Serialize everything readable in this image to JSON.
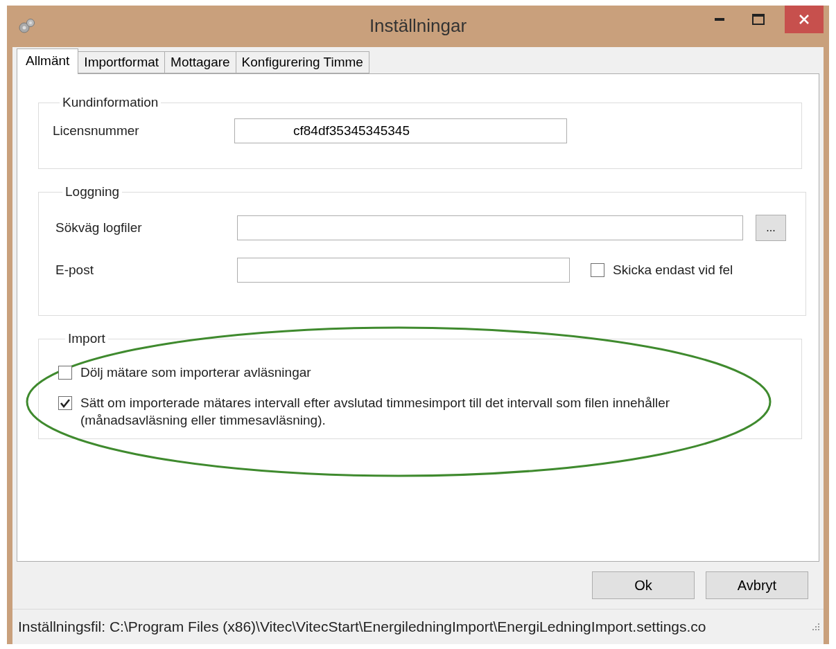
{
  "window": {
    "title": "Inställningar"
  },
  "tabs": [
    {
      "label": "Allmänt",
      "selected": true
    },
    {
      "label": "Importformat",
      "selected": false
    },
    {
      "label": "Mottagare",
      "selected": false
    },
    {
      "label": "Konfigurering Timme",
      "selected": false
    }
  ],
  "customer_info": {
    "title": "Kundinformation",
    "license_label": "Licensnummer",
    "license_value": "cf84df35345345345"
  },
  "logging": {
    "title": "Loggning",
    "path_label": "Sökväg logfiler",
    "browse_button": "...",
    "email_label": "E-post",
    "errors_only": {
      "label": "Skicka endast vid fel",
      "checked": false
    }
  },
  "import": {
    "title": "Import",
    "options": [
      {
        "label": "Dölj mätare som importerar avläsningar",
        "checked": false
      },
      {
        "label": "Sätt om importerade mätares intervall efter avslutad timmesimport till det intervall som filen innehåller (månadsavläsning eller timmesavläsning).",
        "checked": true
      }
    ],
    "highlighted": true
  },
  "buttons": [
    "Ok",
    "Avbryt"
  ],
  "status_bar": "Inställningsfil: C:\\Program Files (x86)\\Vitec\\VitecStart\\EnergiledningImport\\EnergiLedningImport.settings.co"
}
